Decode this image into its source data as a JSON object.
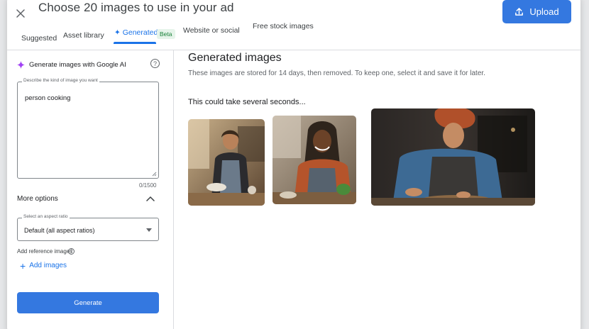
{
  "header": {
    "title": "Choose 20 images to use in your ad",
    "upload_label": "Upload"
  },
  "tabs": [
    {
      "label": "Suggested"
    },
    {
      "label": "Asset library"
    },
    {
      "label": "✦ Generated",
      "active": true,
      "badge": "Beta"
    },
    {
      "label": "Website or social"
    },
    {
      "label": "Free stock images"
    }
  ],
  "left_panel": {
    "heading": "Generate images with Google AI",
    "prompt_label": "Describe the kind of image you want",
    "prompt_value": "person cooking",
    "char_count": "0/1500",
    "more_options": "More options",
    "aspect_label": "Select an aspect ratio",
    "aspect_value": "Default (all aspect ratios)",
    "reference_label": "Add reference images",
    "add_images_label": "Add images",
    "generate_label": "Generate"
  },
  "main": {
    "title": "Generated images",
    "subtitle": "These images are stored for 14 days, then removed. To keep one, select it and save it for later.",
    "status": "This could take several seconds...",
    "images": [
      "generated-image-1",
      "generated-image-2",
      "generated-image-3"
    ]
  },
  "colors": {
    "accent": "#1a73e8",
    "button": "#3478e0",
    "beta_bg": "#e6f4ea",
    "beta_text": "#188038"
  },
  "icons": {
    "close": "close-icon",
    "upload": "upload-icon",
    "spark": "sparkle-icon",
    "help": "help-icon",
    "chevron": "chevron-up-icon",
    "caret": "dropdown-caret-icon",
    "plus": "plus-icon"
  }
}
